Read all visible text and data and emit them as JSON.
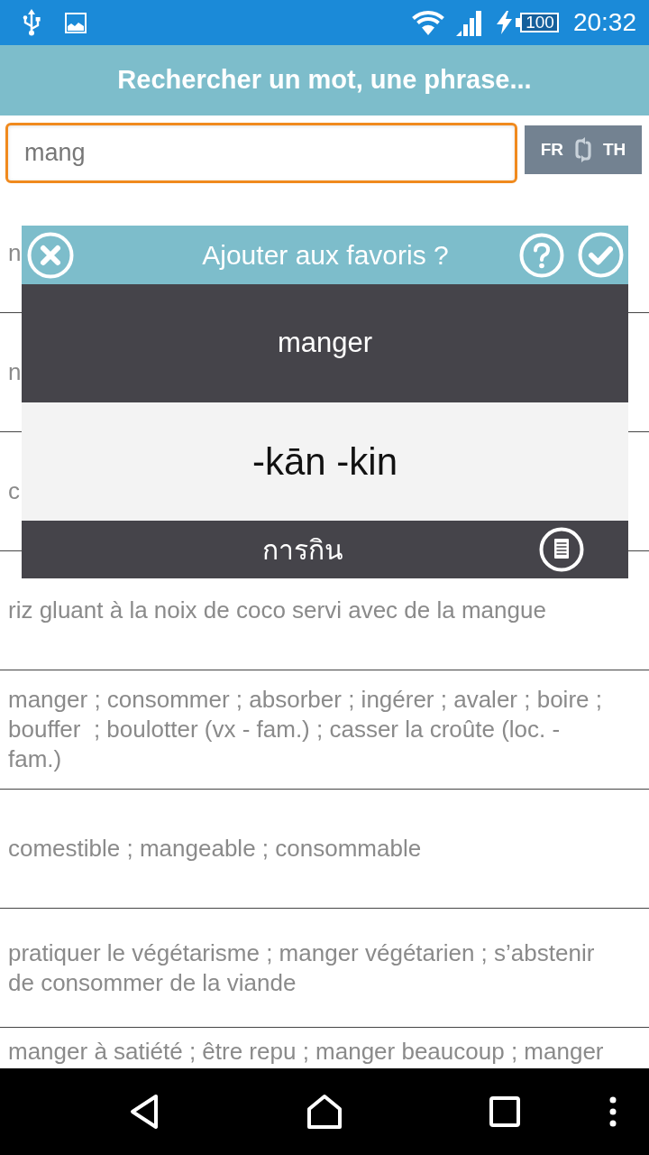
{
  "status_bar": {
    "battery": "100",
    "time": "20:32"
  },
  "header": {
    "title": "Rechercher un mot, une phrase..."
  },
  "search": {
    "value": "mang",
    "focused": true,
    "source_language": "FR",
    "target_language": "TH"
  },
  "results": [
    {
      "text": "n"
    },
    {
      "text": "n"
    },
    {
      "text": "c"
    },
    {
      "text": "riz gluant à la noix de coco servi avec de la mangue"
    },
    {
      "text": "manger ; consommer ; absorber ; ingérer ; avaler ; boire ; bouffer  ; boulotter (vx - fam.) ; casser la croûte (loc. - fam.)"
    },
    {
      "text": "comestible ; mangeable ; consommable"
    },
    {
      "text": "pratiquer le végétarisme ; manger végétarien ; s’abstenir de consommer de la viande"
    },
    {
      "text": "manger à satiété ; être repu ; manger beaucoup ; manger"
    }
  ],
  "dialog": {
    "title": "Ajouter aux favoris ?",
    "word": "manger",
    "transliteration": "-kān -kin",
    "translation": "การกิน"
  }
}
